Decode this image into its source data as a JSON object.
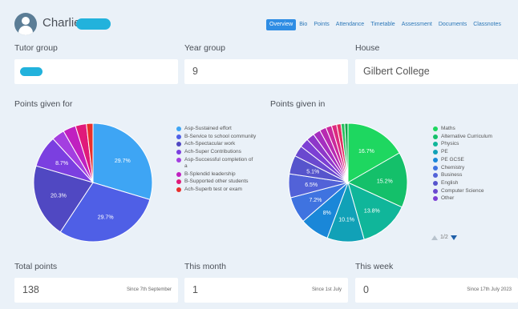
{
  "header": {
    "student_name": "Charlie",
    "tabs": [
      "Overview",
      "Bio",
      "Points",
      "Attendance",
      "Timetable",
      "Assessment",
      "Documents",
      "Classnotes"
    ],
    "active_tab": 0
  },
  "fields": {
    "tutor_group_label": "Tutor group",
    "year_group_label": "Year group",
    "year_group_value": "9",
    "house_label": "House",
    "house_value": "Gilbert College"
  },
  "charts_titles": {
    "points_for": "Points given for",
    "points_in": "Points given in"
  },
  "chart_data": [
    {
      "type": "pie",
      "title": "Points given for",
      "categories": [
        "Asp-Sustained effort",
        "B-Service to school community",
        "Ach-Spectacular work",
        "Ach-Super Contributions",
        "Asp-Successful completion of a",
        "B-Splendid leadership",
        "B-Supported other students",
        "Ach-Superb test or exam"
      ],
      "values": [
        29.7,
        29.7,
        20.3,
        8.7,
        3.5,
        3.5,
        3.0,
        1.8
      ],
      "data_labels": [
        "29.7%",
        "29.7%",
        "20.3%",
        "8.7%",
        "",
        "",
        "",
        ""
      ],
      "colors": [
        "#3ea5f4",
        "#4f5fe6",
        "#5048c2",
        "#7b3fe0",
        "#a43fe0",
        "#c020c0",
        "#e01a7a",
        "#e8302c"
      ],
      "legend_placement": "right"
    },
    {
      "type": "pie",
      "title": "Points given in",
      "categories": [
        "Maths",
        "Alternative Curriculum",
        "Physics",
        "PE",
        "PE GCSE",
        "Chemistry",
        "Business",
        "English",
        "Computer Science",
        "Other"
      ],
      "values": [
        16.7,
        15.2,
        13.8,
        10.1,
        8.0,
        7.2,
        6.5,
        5.1,
        3.0,
        2.5,
        2.2,
        2.0,
        1.8,
        1.6,
        1.4,
        1.2,
        1.0,
        0.9
      ],
      "data_labels": [
        "16.7%",
        "15.2%",
        "13.8%",
        "10.1%",
        "8%",
        "7.2%",
        "6.5%",
        "5.1%",
        "",
        "",
        "",
        "",
        "",
        "",
        "",
        "",
        "",
        ""
      ],
      "colors": [
        "#1ed760",
        "#14c06a",
        "#10b69a",
        "#11a1b7",
        "#1a87d8",
        "#3f73e0",
        "#5262d8",
        "#5654cc",
        "#6a49cf",
        "#7c3fd4",
        "#8e37c9",
        "#a52ec0",
        "#b82ab1",
        "#cb289c",
        "#dc2a80",
        "#e22f63",
        "#28c060",
        "#12a84c"
      ],
      "legend_items": [
        "Maths",
        "Alternative Curriculum",
        "Physics",
        "PE",
        "PE GCSE",
        "Chemistry",
        "Business",
        "English",
        "Computer Science",
        "Other"
      ],
      "legend_placement": "right",
      "pager": "1/2"
    }
  ],
  "totals": {
    "total_label": "Total points",
    "total_value": "138",
    "total_since": "Since 7th September",
    "month_label": "This month",
    "month_value": "1",
    "month_since": "Since 1st July",
    "week_label": "This week",
    "week_value": "0",
    "week_since": "Since 17th July 2023"
  }
}
